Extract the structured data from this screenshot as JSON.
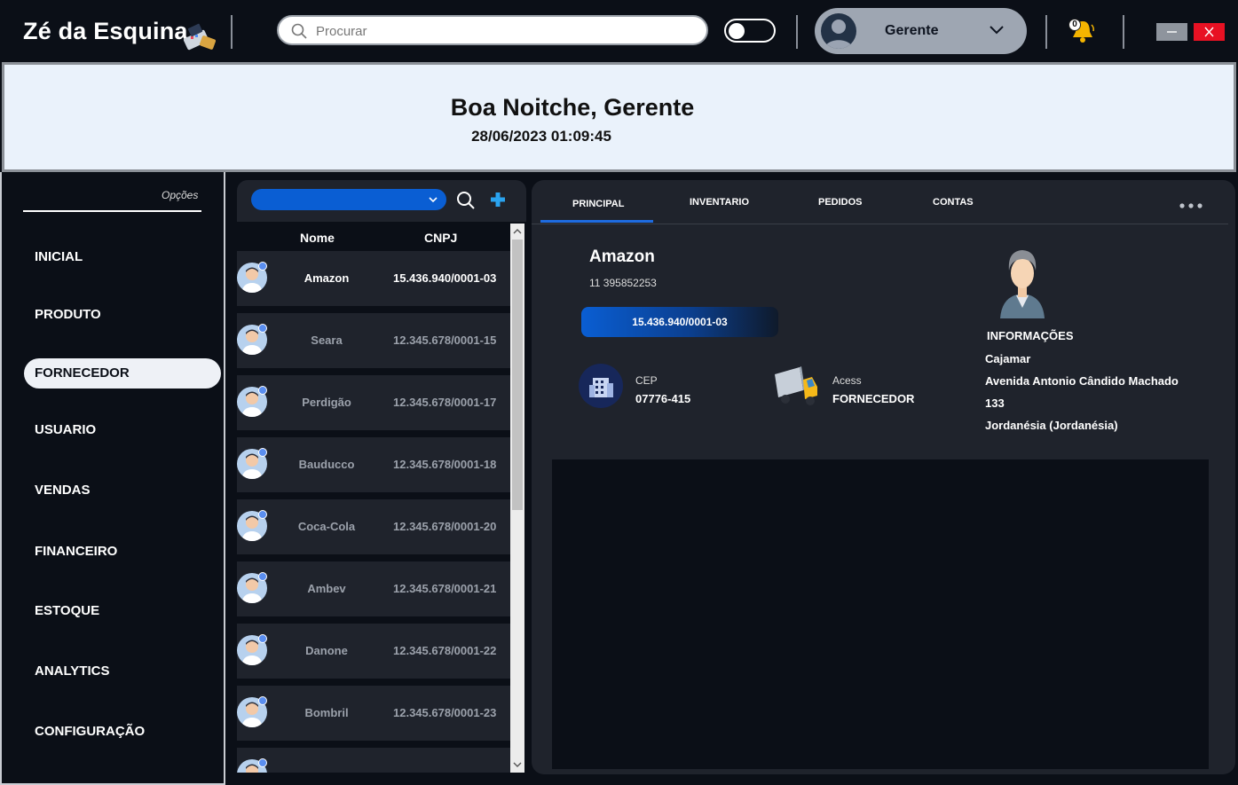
{
  "app": {
    "title": "Zé da Esquina"
  },
  "search": {
    "placeholder": "Procurar"
  },
  "theme_toggle": {
    "on": false
  },
  "user": {
    "name": "Gerente"
  },
  "notifications": {
    "count": "0"
  },
  "banner": {
    "greeting": "Boa Noitche, Gerente",
    "datetime": "28/06/2023 01:09:45"
  },
  "sidebar": {
    "header": "Opções",
    "items": [
      {
        "label": "INICIAL",
        "active": false
      },
      {
        "label": "PRODUTO",
        "active": false
      },
      {
        "label": "FORNECEDOR",
        "active": true
      },
      {
        "label": "USUARIO",
        "active": false
      },
      {
        "label": "VENDAS",
        "active": false
      },
      {
        "label": "FINANCEIRO",
        "active": false
      },
      {
        "label": "ESTOQUE",
        "active": false
      },
      {
        "label": "ANALYTICS",
        "active": false
      },
      {
        "label": "CONFIGURAÇÃO",
        "active": false
      }
    ]
  },
  "supplier_list": {
    "columns": {
      "name": "Nome",
      "cnpj": "CNPJ"
    },
    "rows": [
      {
        "name": "Amazon",
        "cnpj": "15.436.940/0001-03",
        "selected": true
      },
      {
        "name": "Seara",
        "cnpj": "12.345.678/0001-15",
        "selected": false
      },
      {
        "name": "Perdigão",
        "cnpj": "12.345.678/0001-17",
        "selected": false
      },
      {
        "name": "Bauducco",
        "cnpj": "12.345.678/0001-18",
        "selected": false
      },
      {
        "name": "Coca-Cola",
        "cnpj": "12.345.678/0001-20",
        "selected": false
      },
      {
        "name": "Ambev",
        "cnpj": "12.345.678/0001-21",
        "selected": false
      },
      {
        "name": "Danone",
        "cnpj": "12.345.678/0001-22",
        "selected": false
      },
      {
        "name": "Bombril",
        "cnpj": "12.345.678/0001-23",
        "selected": false
      }
    ]
  },
  "detail": {
    "tabs": [
      {
        "label": "PRINCIPAL",
        "active": true
      },
      {
        "label": "INVENTARIO",
        "active": false
      },
      {
        "label": "PEDIDOS",
        "active": false
      },
      {
        "label": "CONTAS",
        "active": false
      }
    ],
    "name": "Amazon",
    "phone": "11 395852253",
    "cnpj": "15.436.940/0001-03",
    "cep_label": "CEP",
    "cep_value": "07776-415",
    "access_label": "Acess",
    "access_value": "FORNECEDOR",
    "info_title": "INFORMAÇÕES",
    "info_lines": [
      "Cajamar",
      "Avenida Antonio Cândido Machado",
      "133",
      "Jordanésia (Jordanésia)"
    ]
  },
  "colors": {
    "accent": "#0a5ed3",
    "panel": "#1f232c",
    "background": "#0b0f17",
    "close": "#e81123"
  }
}
